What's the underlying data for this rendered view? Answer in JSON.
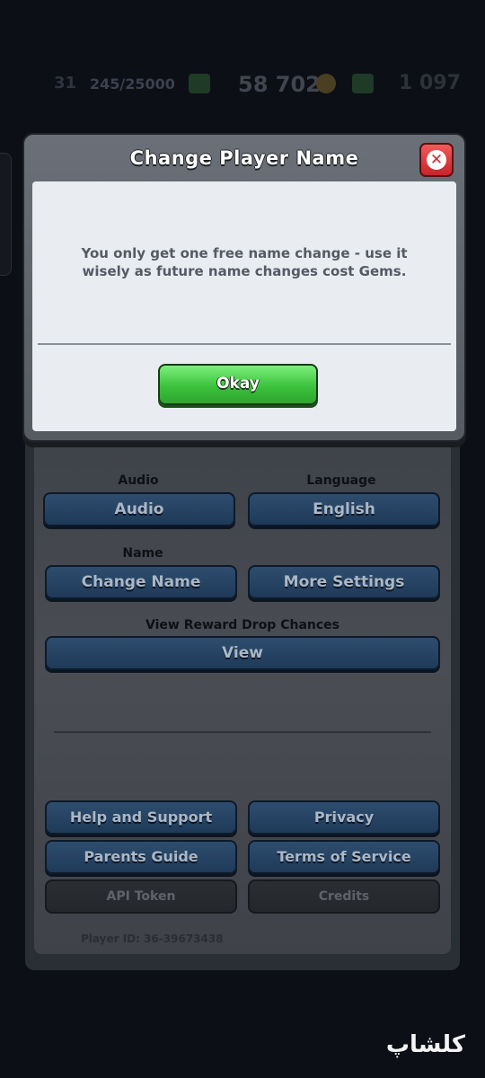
{
  "background_hud": {
    "trophies": "31",
    "progress": "245/25000",
    "gold": "58 702",
    "gems": "1 097"
  },
  "settings": {
    "audio_label": "Audio",
    "audio_button": "Audio",
    "language_label": "Language",
    "language_button": "English",
    "name_label": "Name",
    "change_name_button": "Change Name",
    "more_settings_button": "More Settings",
    "reward_label": "View Reward Drop Chances",
    "view_button": "View",
    "help_button": "Help and Support",
    "privacy_button": "Privacy",
    "parents_button": "Parents Guide",
    "terms_button": "Terms of Service",
    "api_button": "API Token",
    "credits_button": "Credits",
    "player_id": "Player ID: 36-39673438"
  },
  "modal": {
    "title": "Change Player Name",
    "message": "You only get one free name change - use it wisely as future name changes cost Gems.",
    "okay_button": "Okay",
    "close_icon": "close-icon"
  },
  "watermark": "کلشاپ",
  "colors": {
    "okay_green": "#3cc23c",
    "close_red": "#d22a2e",
    "settings_blue": "#1f3a59"
  }
}
